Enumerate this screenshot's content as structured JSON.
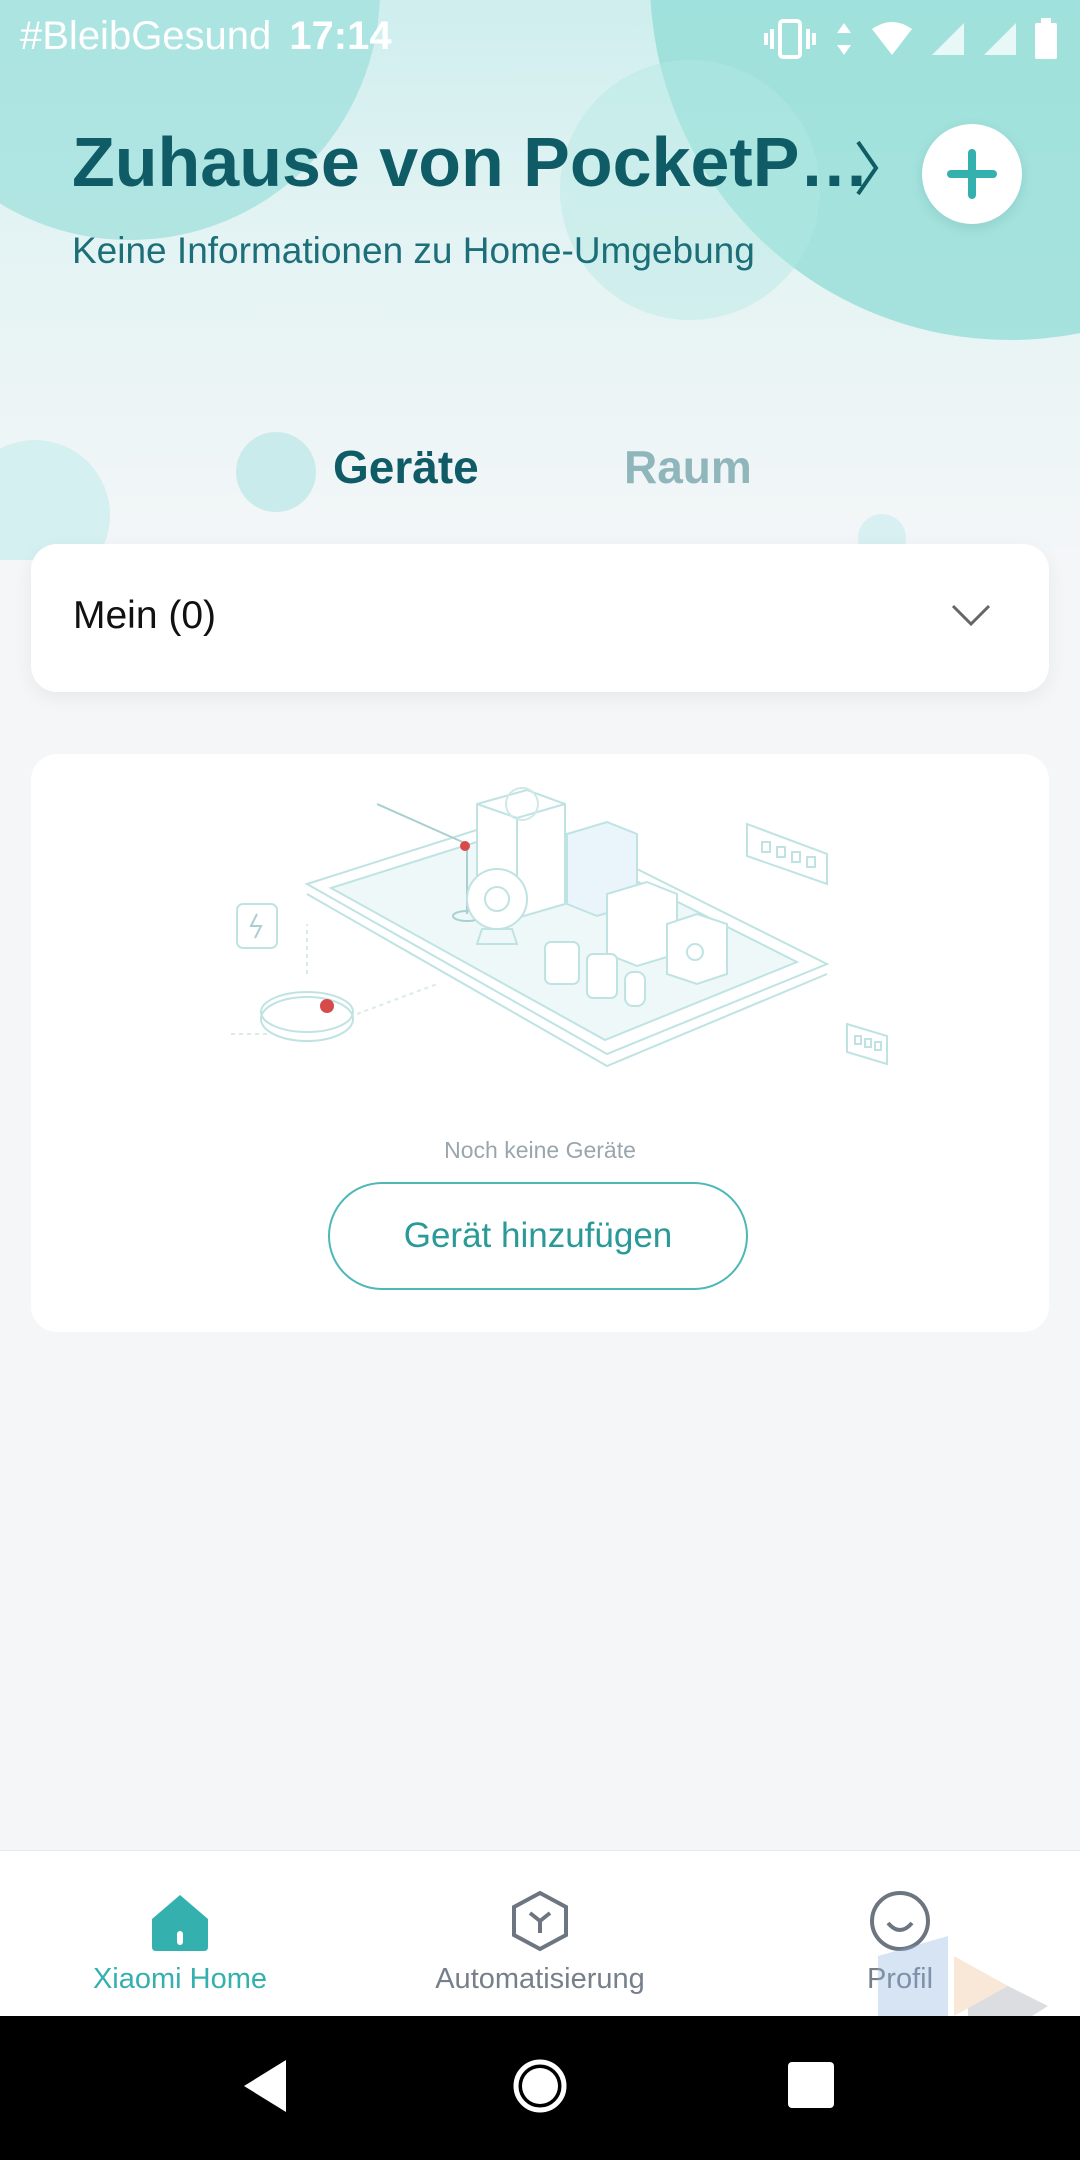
{
  "status_bar": {
    "carrier_text": "#BleibGesund",
    "time": "17:14",
    "icons": [
      "vibrate-icon",
      "data-arrows-icon",
      "wifi-icon",
      "signal-icon",
      "signal-icon",
      "battery-icon"
    ]
  },
  "header": {
    "title": "Zuhause von PocketP…",
    "subtitle": "Keine Informationen zu Home-Umgebung",
    "chevron_icon": "chevron-right-icon",
    "add_icon": "plus-icon"
  },
  "tabs": [
    {
      "label": "Geräte",
      "active": true
    },
    {
      "label": "Raum",
      "active": false
    }
  ],
  "group_selector": {
    "label": "Mein (0)",
    "icon": "chevron-down-icon"
  },
  "empty_state": {
    "message": "Noch keine Geräte",
    "button_label": "Gerät hinzufügen",
    "illustration": "smart-devices-illustration"
  },
  "bottom_nav": [
    {
      "label": "Xiaomi Home",
      "icon": "home-icon",
      "active": true
    },
    {
      "label": "Automatisierung",
      "icon": "automation-icon",
      "active": false
    },
    {
      "label": "Profil",
      "icon": "profile-icon",
      "active": false
    }
  ],
  "system_nav": [
    "back-icon",
    "home-circle-icon",
    "recents-icon"
  ],
  "colors": {
    "accent": "#34b0af",
    "title": "#0f5c66",
    "inactive_tab": "#8fb6ba",
    "background": "#f4f6f8"
  }
}
